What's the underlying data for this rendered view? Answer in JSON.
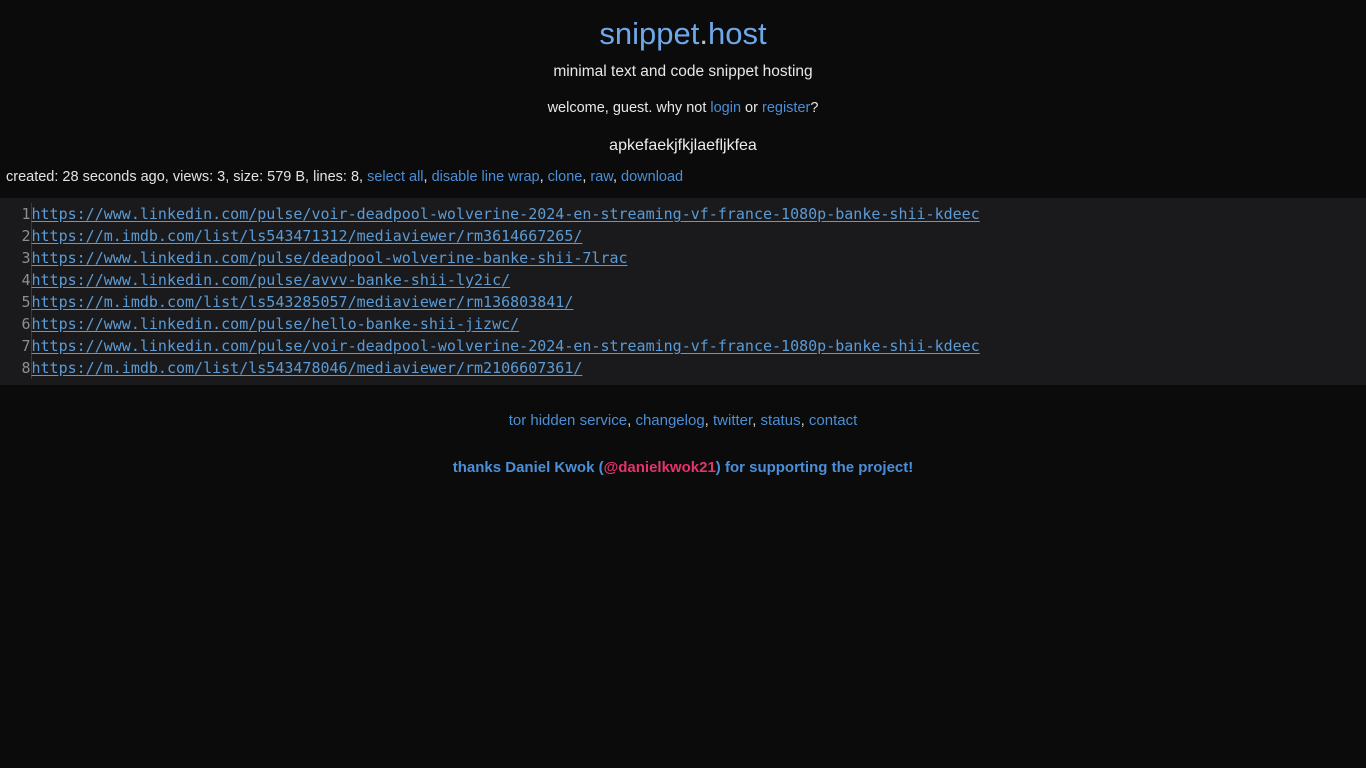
{
  "site": {
    "logo_name": "snippet",
    "logo_dot": ".",
    "logo_tld": "host",
    "tagline": "minimal text and code snippet hosting"
  },
  "welcome": {
    "prefix": "welcome, guest. why not ",
    "login_label": "login",
    "separator": " or ",
    "register_label": "register",
    "suffix": "?"
  },
  "snippet": {
    "title": "apkefaekjfkjlaefljkfea",
    "meta": {
      "created_label": "created:",
      "created_value": "28 seconds ago",
      "views_label": "views:",
      "views_value": "3",
      "size_label": "size:",
      "size_value": "579 B",
      "lines_label": "lines:",
      "lines_value": "8",
      "full_text": "created: 28 seconds ago, views: 3, size: 579 B, lines: 8,",
      "actions": [
        {
          "label": "select all"
        },
        {
          "label": "disable line wrap"
        },
        {
          "label": "clone"
        },
        {
          "label": "raw"
        },
        {
          "label": "download"
        }
      ]
    },
    "lines": [
      {
        "n": "1",
        "text": "https://www.linkedin.com/pulse/voir-deadpool-wolverine-2024-en-streaming-vf-france-1080p-banke-shii-kdeec"
      },
      {
        "n": "2",
        "text": "https://m.imdb.com/list/ls543471312/mediaviewer/rm3614667265/"
      },
      {
        "n": "3",
        "text": "https://www.linkedin.com/pulse/deadpool-wolverine-banke-shii-7lrac"
      },
      {
        "n": "4",
        "text": "https://www.linkedin.com/pulse/avvv-banke-shii-ly2ic/"
      },
      {
        "n": "5",
        "text": "https://m.imdb.com/list/ls543285057/mediaviewer/rm136803841/"
      },
      {
        "n": "6",
        "text": "https://www.linkedin.com/pulse/hello-banke-shii-jizwc/"
      },
      {
        "n": "7",
        "text": "https://www.linkedin.com/pulse/voir-deadpool-wolverine-2024-en-streaming-vf-france-1080p-banke-shii-kdeec"
      },
      {
        "n": "8",
        "text": "https://m.imdb.com/list/ls543478046/mediaviewer/rm2106607361/"
      }
    ]
  },
  "footer": {
    "links": [
      {
        "label": "tor hidden service"
      },
      {
        "label": "changelog"
      },
      {
        "label": "twitter"
      },
      {
        "label": "status"
      },
      {
        "label": "contact"
      }
    ],
    "thanks_prefix": "thanks Daniel Kwok (",
    "thanks_handle": "@danielkwok21",
    "thanks_suffix": ") for supporting the project!"
  },
  "colors": {
    "page_bg": "#0b0b0c",
    "code_bg": "#1a1a1c",
    "link": "#4a8fd8",
    "logo": "#6fa8e8",
    "code_link": "#5b9bd5",
    "gutter_text": "#8e8e8e",
    "accent_pink": "#e5336b",
    "body_text": "#e6e6e6"
  }
}
